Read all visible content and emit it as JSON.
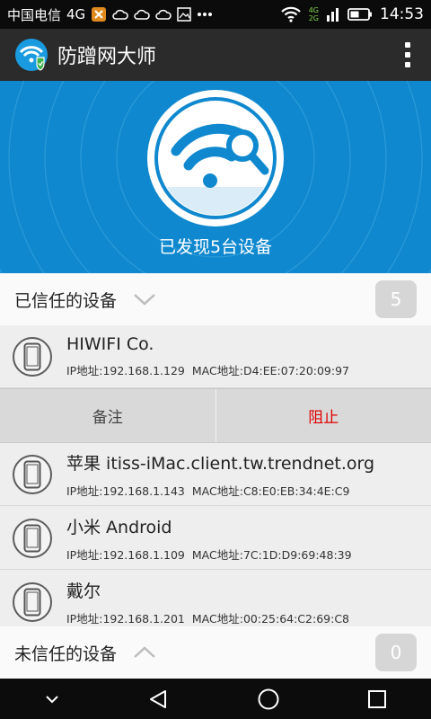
{
  "statusbar": {
    "carrier": "中国电信",
    "network": "4G",
    "signal_small": "4G",
    "signal_small2": "2G",
    "time": "14:53"
  },
  "appbar": {
    "title": "防蹭网大师",
    "logo_icon": "wifi-shield-icon",
    "menu_icon": "overflow-menu-icon"
  },
  "hero": {
    "status_text": "已发现5台设备",
    "icon": "wifi-search-icon",
    "colors": {
      "background": "#0f88cf",
      "circle": "#ffffff",
      "icon": "#0f88cf"
    }
  },
  "trusted": {
    "label": "已信任的设备",
    "count": "5",
    "chevron_icon": "chevron-down-icon"
  },
  "devices": [
    {
      "name": "HIWIFI Co.",
      "ip_label": "IP地址:",
      "ip": "192.168.1.129",
      "mac_label": "MAC地址:",
      "mac": "D4:EE:07:20:09:97"
    },
    {
      "name": "苹果 itiss-iMac.client.tw.trendnet.org",
      "ip_label": "IP地址:",
      "ip": "192.168.1.143",
      "mac_label": "MAC地址:",
      "mac": "C8:E0:EB:34:4E:C9"
    },
    {
      "name": "小米 Android",
      "ip_label": "IP地址:",
      "ip": "192.168.1.109",
      "mac_label": "MAC地址:",
      "mac": "7C:1D:D9:69:48:39"
    },
    {
      "name": "戴尔",
      "ip_label": "IP地址:",
      "ip": "192.168.1.201",
      "mac_label": "MAC地址:",
      "mac": "00:25:64:C2:69:C8"
    }
  ],
  "actions": {
    "note_label": "备注",
    "block_label": "阻止",
    "block_color": "#e00000"
  },
  "untrusted": {
    "label": "未信任的设备",
    "count": "0",
    "chevron_icon": "chevron-up-icon"
  },
  "navbar": {
    "icons": [
      "down-arrow-icon",
      "back-icon",
      "home-icon",
      "recents-icon"
    ]
  }
}
